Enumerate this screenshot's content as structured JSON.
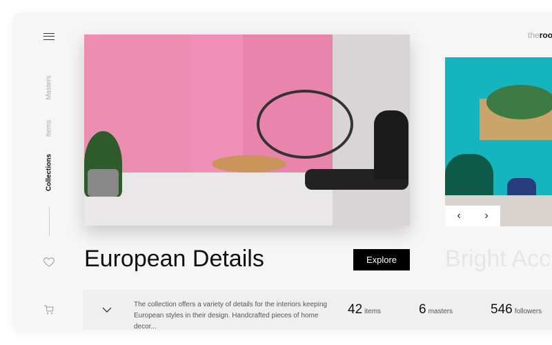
{
  "brand": {
    "logo_prefix": "the",
    "logo_rest": "roo"
  },
  "sidebar": {
    "items": [
      {
        "label": "Masters"
      },
      {
        "label": "Items"
      },
      {
        "label": "Collections",
        "active": true
      }
    ],
    "icons": [
      "menu-icon",
      "heart-icon",
      "cart-icon"
    ]
  },
  "main": {
    "title": "European Details",
    "explore_label": "Explore",
    "next_title": "Bright Acc"
  },
  "info": {
    "description": "The collection offers a variety of details for the interiors keeping European styles in their design. Handcrafted pieces of home decor...",
    "stats": [
      {
        "value": "42",
        "label": "items"
      },
      {
        "value": "6",
        "label": "masters"
      },
      {
        "value": "546",
        "label": "followers"
      }
    ]
  },
  "colors": {
    "accent": "#000000",
    "pink_wall": "#e889ad",
    "teal_wall": "#15b5bf"
  }
}
